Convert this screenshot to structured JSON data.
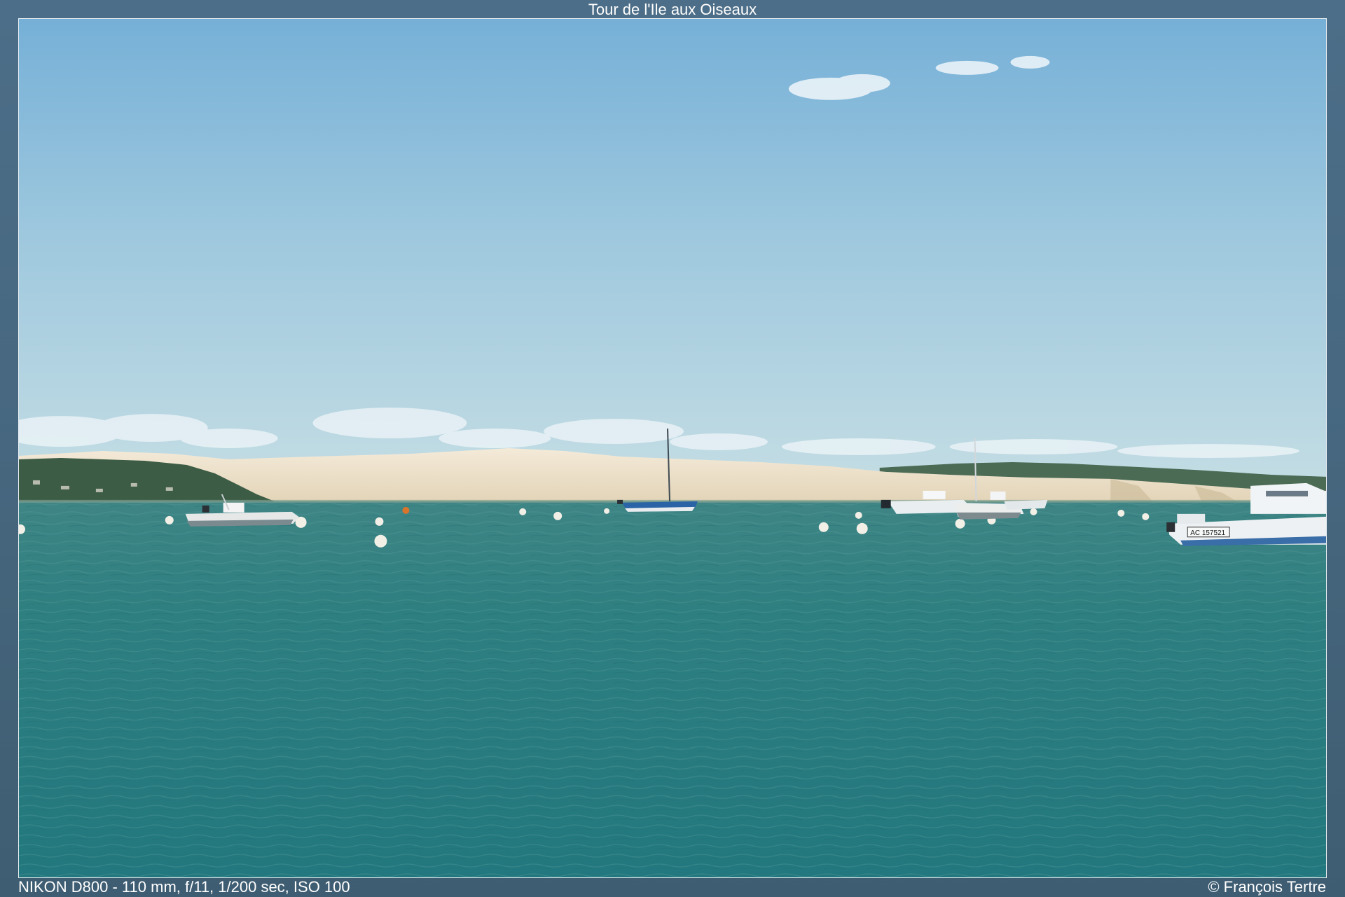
{
  "photo": {
    "title": "Tour de l'Ile aux Oiseaux",
    "camera_info": "NIKON D800 - 110 mm, f/11, 1/200 sec, ISO 100",
    "copyright": "© François Tertre",
    "registration_text": "AC 157521"
  },
  "colors": {
    "frame": "#4a6b84",
    "sky_top": "#79b2d8",
    "sky_horizon": "#c4dde4",
    "sand": "#efe4cf",
    "forest": "#3d5c46",
    "water": "#2b7a7c"
  }
}
